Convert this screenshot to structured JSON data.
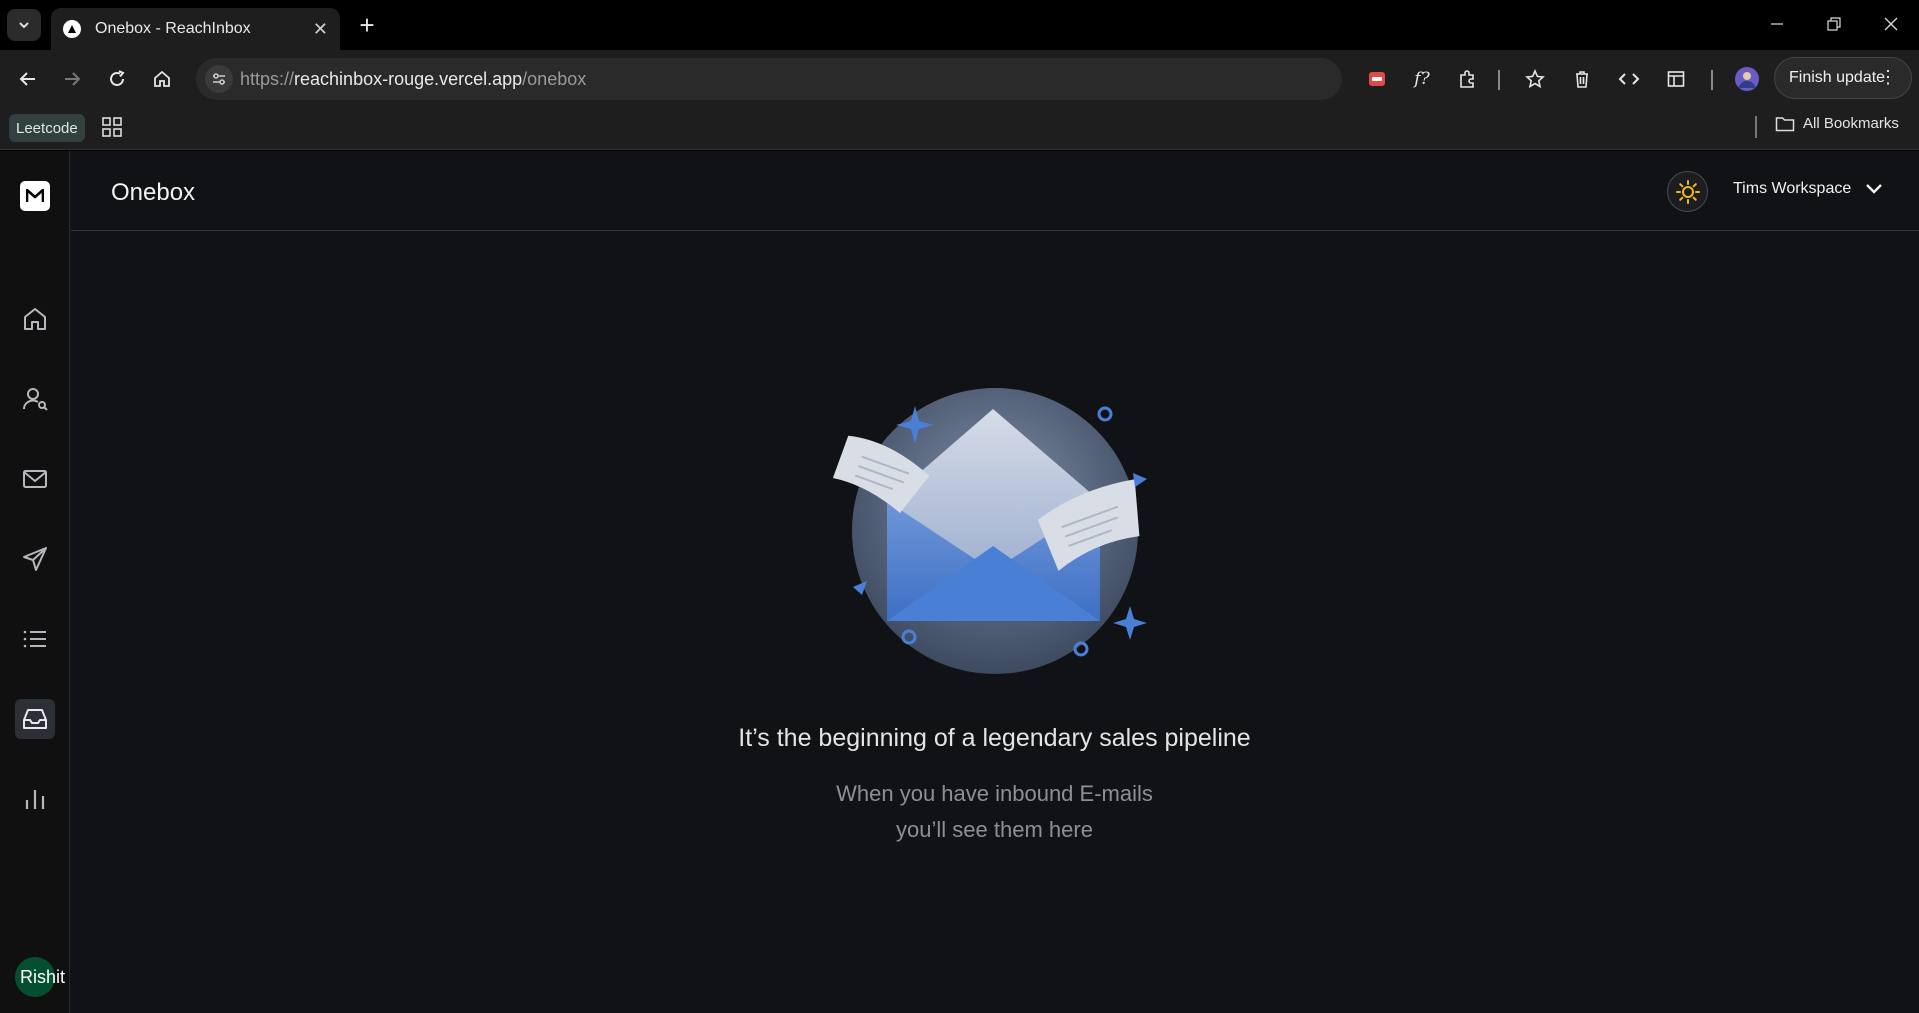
{
  "browser": {
    "tab_title": "Onebox - ReachInbox",
    "url_scheme": "https://",
    "url_host": "reachinbox-rouge.vercel.app",
    "url_path": "/onebox",
    "finish_update_label": "Finish update",
    "bookmarks": {
      "leetcode_label": "Leetcode",
      "all_bookmarks_label": "All Bookmarks"
    }
  },
  "app": {
    "page_title": "Onebox",
    "workspace_label": "Tims Workspace",
    "user_name": "Rishit",
    "sidebar": {
      "items": [
        {
          "name": "home",
          "icon": "home-icon",
          "active": false
        },
        {
          "name": "users",
          "icon": "user-search-icon",
          "active": false
        },
        {
          "name": "mail",
          "icon": "mail-icon",
          "active": false
        },
        {
          "name": "send",
          "icon": "send-icon",
          "active": false
        },
        {
          "name": "list",
          "icon": "list-icon",
          "active": false
        },
        {
          "name": "inbox",
          "icon": "inbox-icon",
          "active": true
        },
        {
          "name": "analytics",
          "icon": "bar-chart-icon",
          "active": false
        }
      ]
    },
    "empty_state": {
      "headline": "It’s the beginning of a legendary sales pipeline",
      "line1": "When you have inbound E-mails",
      "line2": "you’ll see them here"
    },
    "colors": {
      "background": "#111215",
      "accent": "#4a7fd6",
      "avatar": "#054f31"
    }
  }
}
